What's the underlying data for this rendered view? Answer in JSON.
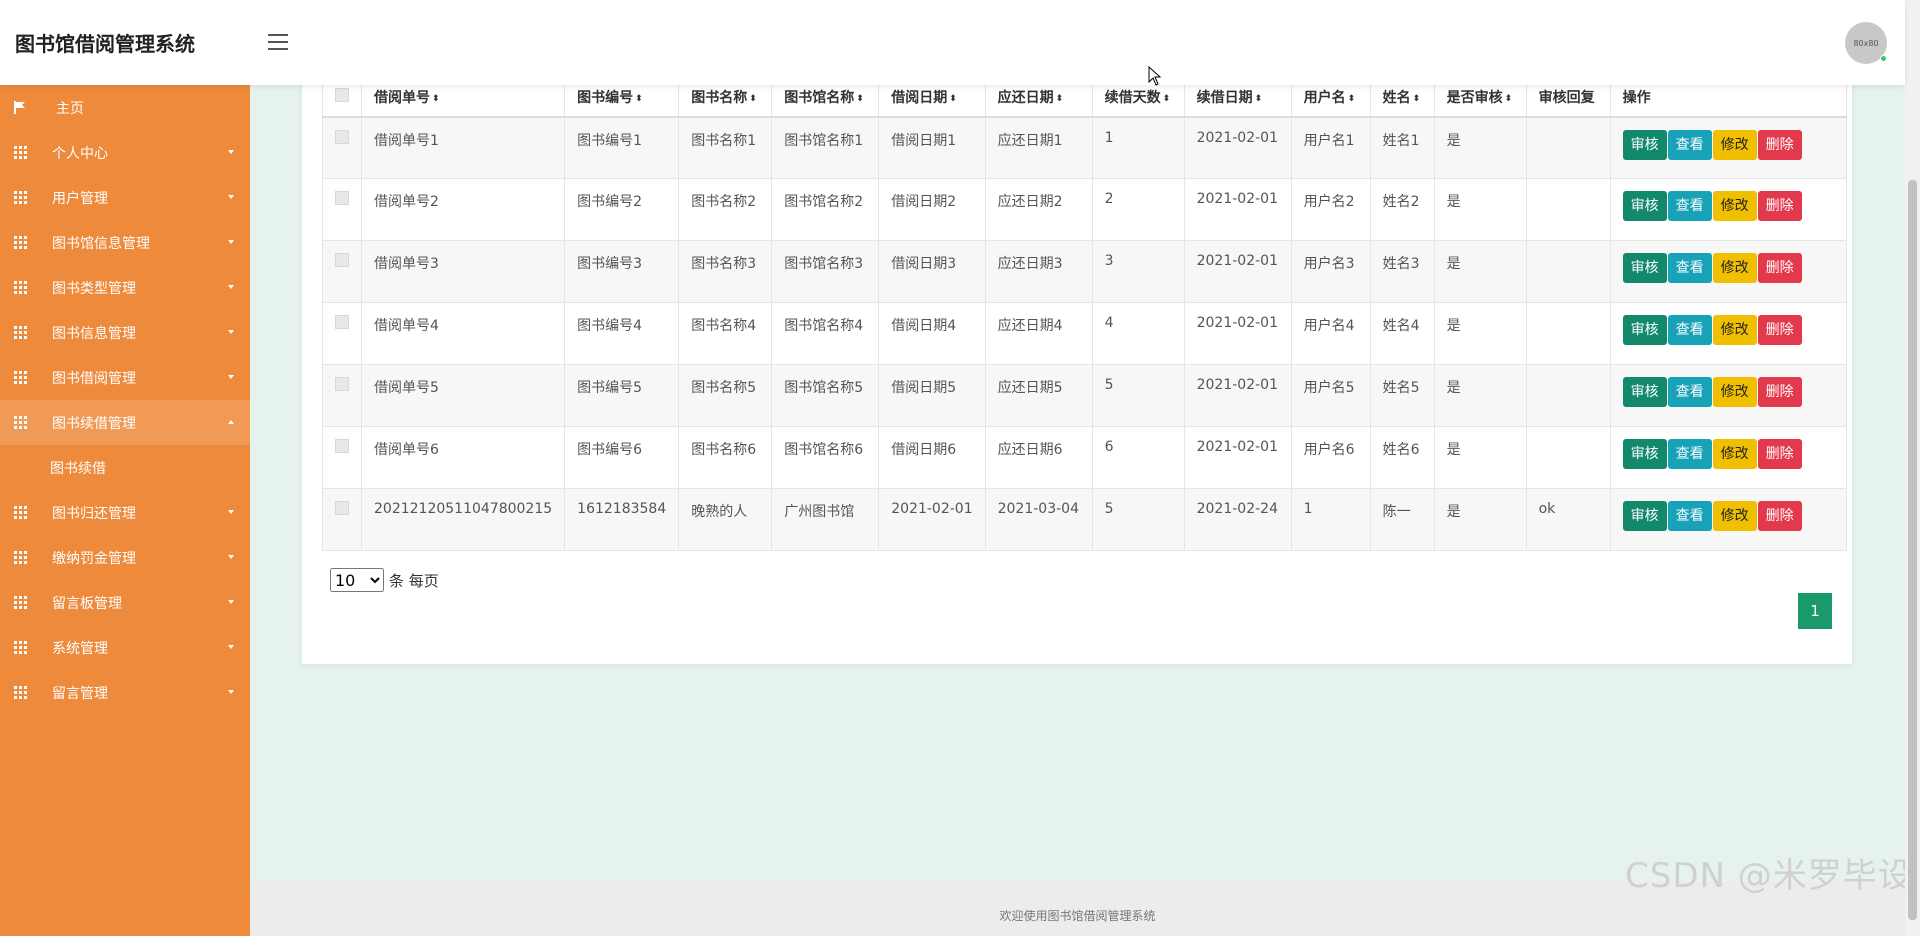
{
  "header": {
    "app_title": "图书馆借阅管理系统",
    "avatar_label": "80x80"
  },
  "sidebar": {
    "items": [
      {
        "label": "主页",
        "icon": "flag-icon",
        "expanded": false
      },
      {
        "label": "个人中心",
        "icon": "grid-icon",
        "expanded": false
      },
      {
        "label": "用户管理",
        "icon": "grid-icon",
        "expanded": false
      },
      {
        "label": "图书馆信息管理",
        "icon": "grid-icon",
        "expanded": false
      },
      {
        "label": "图书类型管理",
        "icon": "grid-icon",
        "expanded": false
      },
      {
        "label": "图书信息管理",
        "icon": "grid-icon",
        "expanded": false
      },
      {
        "label": "图书借阅管理",
        "icon": "grid-icon",
        "expanded": false
      },
      {
        "label": "图书续借管理",
        "icon": "grid-icon",
        "expanded": true
      },
      {
        "label": "图书归还管理",
        "icon": "grid-icon",
        "expanded": false
      },
      {
        "label": "缴纳罚金管理",
        "icon": "grid-icon",
        "expanded": false
      },
      {
        "label": "留言板管理",
        "icon": "grid-icon",
        "expanded": false
      },
      {
        "label": "系统管理",
        "icon": "grid-icon",
        "expanded": false
      },
      {
        "label": "留言管理",
        "icon": "grid-icon",
        "expanded": false
      }
    ],
    "subitem": "图书续借"
  },
  "table": {
    "columns": [
      "借阅单号",
      "图书编号",
      "图书名称",
      "图书馆名称",
      "借阅日期",
      "应还日期",
      "续借天数",
      "续借日期",
      "用户名",
      "姓名",
      "是否审核",
      "审核回复",
      "操作"
    ],
    "rows": [
      [
        "借阅单号1",
        "图书编号1",
        "图书名称1",
        "图书馆名称1",
        "借阅日期1",
        "应还日期1",
        "1",
        "2021-02-01",
        "用户名1",
        "姓名1",
        "是",
        ""
      ],
      [
        "借阅单号2",
        "图书编号2",
        "图书名称2",
        "图书馆名称2",
        "借阅日期2",
        "应还日期2",
        "2",
        "2021-02-01",
        "用户名2",
        "姓名2",
        "是",
        ""
      ],
      [
        "借阅单号3",
        "图书编号3",
        "图书名称3",
        "图书馆名称3",
        "借阅日期3",
        "应还日期3",
        "3",
        "2021-02-01",
        "用户名3",
        "姓名3",
        "是",
        ""
      ],
      [
        "借阅单号4",
        "图书编号4",
        "图书名称4",
        "图书馆名称4",
        "借阅日期4",
        "应还日期4",
        "4",
        "2021-02-01",
        "用户名4",
        "姓名4",
        "是",
        ""
      ],
      [
        "借阅单号5",
        "图书编号5",
        "图书名称5",
        "图书馆名称5",
        "借阅日期5",
        "应还日期5",
        "5",
        "2021-02-01",
        "用户名5",
        "姓名5",
        "是",
        ""
      ],
      [
        "借阅单号6",
        "图书编号6",
        "图书名称6",
        "图书馆名称6",
        "借阅日期6",
        "应还日期6",
        "6",
        "2021-02-01",
        "用户名6",
        "姓名6",
        "是",
        ""
      ],
      [
        "20212120511047800215",
        "1612183584",
        "晚熟的人",
        "广州图书馆",
        "2021-02-01",
        "2021-03-04",
        "5",
        "2021-02-24",
        "1",
        "陈一",
        "是",
        "ok"
      ]
    ],
    "actions": {
      "audit": "审核",
      "view": "查看",
      "edit": "修改",
      "delete": "删除"
    }
  },
  "pagination": {
    "page_size": "10",
    "page_size_suffix": "条 每页",
    "current_page": "1"
  },
  "footer": {
    "text": "欢迎使用图书馆借阅管理系统"
  },
  "watermark": "CSDN @米罗毕设",
  "colors": {
    "sidebar": "#ee8a3c",
    "audit": "#13896b",
    "view": "#17a2b8",
    "edit": "#f0c000",
    "delete": "#e3394c",
    "page": "#1a9a6a"
  }
}
